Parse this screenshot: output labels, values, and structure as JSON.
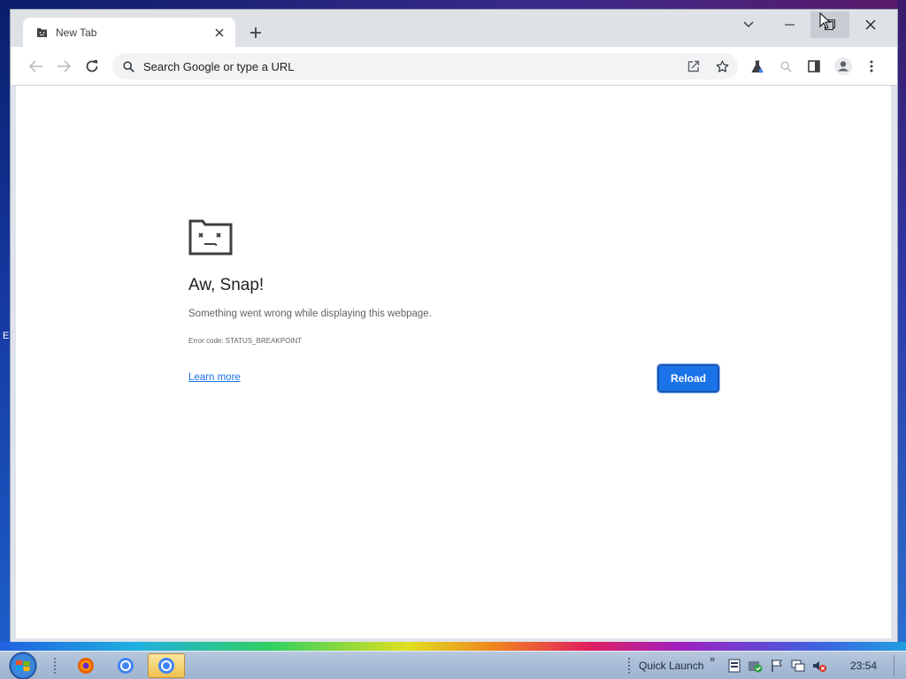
{
  "browser": {
    "tab": {
      "title": "New Tab"
    },
    "omnibox": {
      "placeholder": "Search Google or type a URL"
    }
  },
  "error_page": {
    "heading": "Aw, Snap!",
    "message": "Something went wrong while displaying this webpage.",
    "error_code": "Error code: STATUS_BREAKPOINT",
    "learn_more": "Learn more",
    "reload_label": "Reload"
  },
  "taskbar": {
    "quick_launch_label": "Quick Launch",
    "chevron": "»",
    "clock": "23:54"
  },
  "desktop": {
    "edge_glyph": "E"
  },
  "colors": {
    "accent": "#1a73e8",
    "tabstrip": "#dee1e6",
    "page_bg": "#ffffff"
  },
  "icons": [
    "tab-sad-favicon-icon",
    "close-icon",
    "plus-icon",
    "chevron-down-icon",
    "minimize-icon",
    "restore-icon",
    "back-arrow-icon",
    "forward-arrow-icon",
    "reload-icon",
    "search-icon",
    "share-icon",
    "star-icon",
    "labs-flask-icon",
    "zoom-icon",
    "side-panel-icon",
    "profile-icon",
    "menu-kebab-icon",
    "sad-tab-icon",
    "windows-start-icon",
    "firefox-icon",
    "chrome-icon"
  ]
}
